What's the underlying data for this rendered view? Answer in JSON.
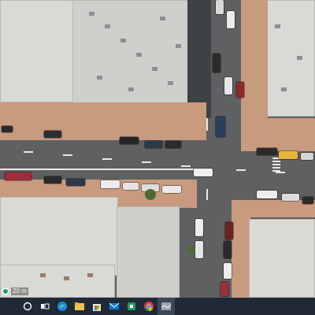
{
  "map": {
    "view": "satellite",
    "scale_label": "20 m"
  },
  "taskbar": {
    "items": [
      {
        "name": "start-circle-icon"
      },
      {
        "name": "task-view-icon"
      },
      {
        "name": "edge-browser-icon"
      },
      {
        "name": "file-explorer-icon"
      },
      {
        "name": "microsoft-store-icon"
      },
      {
        "name": "mail-icon"
      },
      {
        "name": "green-app-icon"
      },
      {
        "name": "chrome-icon"
      },
      {
        "name": "maps-app-icon"
      }
    ]
  },
  "colors": {
    "road": "#5f6062",
    "sidewalk": "#c89a7e",
    "roof": "#d9d9d6",
    "taskbar": "#1f2a36",
    "lane_marking": "#e8e8e8"
  }
}
